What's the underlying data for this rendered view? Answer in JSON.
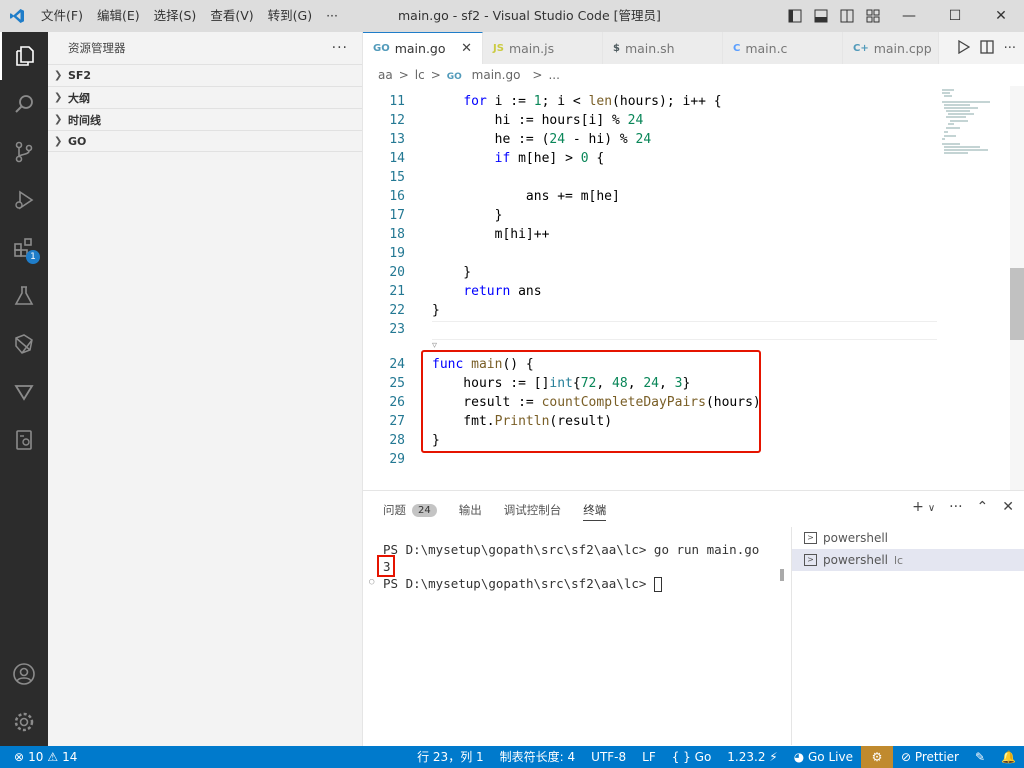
{
  "titlebar": {
    "menu": [
      "文件(F)",
      "编辑(E)",
      "选择(S)",
      "查看(V)",
      "转到(G)",
      "···"
    ],
    "title": "main.go - sf2 - Visual Studio Code [管理员]"
  },
  "activity_bar": {
    "extensions_badge": "1"
  },
  "sidebar": {
    "title": "资源管理器",
    "more": "···",
    "sections": [
      "SF2",
      "大纲",
      "时间线",
      "GO"
    ]
  },
  "tabs": [
    {
      "label": "main.go",
      "icon": "go-icon",
      "icon_text": "GO",
      "icon_color": "#519aba"
    },
    {
      "label": "main.js",
      "icon": "js-icon",
      "icon_text": "JS",
      "icon_color": "#cbcb41"
    },
    {
      "label": "main.sh",
      "icon": "shell-icon",
      "icon_text": "$",
      "icon_color": "#4d5a5e"
    },
    {
      "label": "main.c",
      "icon": "c-icon",
      "icon_text": "C",
      "icon_color": "#599eff"
    },
    {
      "label": "main.cpp",
      "icon": "cpp-icon",
      "icon_text": "C+",
      "icon_color": "#519aba"
    }
  ],
  "breadcrumb": [
    "aa",
    ">",
    "lc",
    ">",
    "main.go",
    ">",
    "..."
  ],
  "code_lines": [
    {
      "num": "11",
      "text": "    for i := 1; i < len(hours); i++ {"
    },
    {
      "num": "12",
      "text": "        hi := hours[i] % 24"
    },
    {
      "num": "13",
      "text": "        he := (24 - hi) % 24"
    },
    {
      "num": "14",
      "text": "        if m[he] > 0 {"
    },
    {
      "num": "15",
      "text": ""
    },
    {
      "num": "16",
      "text": "            ans += m[he]"
    },
    {
      "num": "17",
      "text": "        }"
    },
    {
      "num": "18",
      "text": "        m[hi]++"
    },
    {
      "num": "19",
      "text": ""
    },
    {
      "num": "20",
      "text": "    }"
    },
    {
      "num": "21",
      "text": "    return ans"
    },
    {
      "num": "22",
      "text": "}"
    },
    {
      "num": "23",
      "text": ""
    },
    {
      "num": "24",
      "text": "func main() {"
    },
    {
      "num": "25",
      "text": "    hours := []int{72, 48, 24, 3}"
    },
    {
      "num": "26",
      "text": "    result := countCompleteDayPairs(hours)"
    },
    {
      "num": "27",
      "text": "    fmt.Println(result)"
    },
    {
      "num": "28",
      "text": "}"
    },
    {
      "num": "29",
      "text": ""
    }
  ],
  "panel": {
    "tabs": [
      "问题",
      "输出",
      "调试控制台",
      "终端"
    ],
    "problems_count": "24",
    "terminal_lines": [
      "PS D:\\mysetup\\gopath\\src\\sf2\\aa\\lc> go run main.go",
      "3",
      "PS D:\\mysetup\\gopath\\src\\sf2\\aa\\lc> "
    ],
    "terminals": [
      {
        "label": "powershell",
        "sub": ""
      },
      {
        "label": "powershell",
        "sub": "lc"
      }
    ]
  },
  "statusbar": {
    "errors": "10",
    "warnings": "14",
    "position": "行 23，列 1",
    "tab_size": "制表符长度: 4",
    "encoding": "UTF-8",
    "eol": "LF",
    "language": "Go",
    "go_version": "1.23.2",
    "go_live": "Go Live",
    "prettier": "Prettier"
  }
}
